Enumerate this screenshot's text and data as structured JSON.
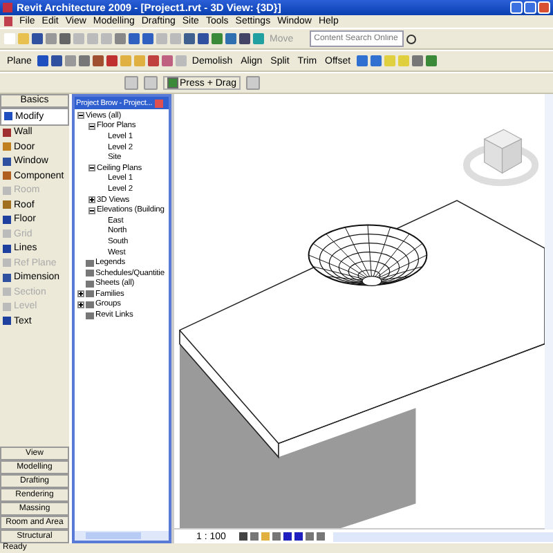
{
  "window": {
    "title": "Revit Architecture 2009 - [Project1.rvt - 3D View: {3D}]"
  },
  "menu": [
    "File",
    "Edit",
    "View",
    "Modelling",
    "Drafting",
    "Site",
    "Tools",
    "Settings",
    "Window",
    "Help"
  ],
  "toolbar": {
    "move": {
      "label": "Move",
      "disabled": true
    },
    "search": {
      "placeholder": "Content Search Online"
    }
  },
  "edit_toolbar": [
    {
      "label": "Plane"
    },
    {
      "label": "Demolish"
    },
    {
      "label": "Align"
    },
    {
      "label": "Split"
    },
    {
      "label": "Trim"
    },
    {
      "label": "Offset"
    }
  ],
  "options_bar": {
    "press_drag": {
      "label": "Press + Drag",
      "checked": true
    }
  },
  "design_bar": {
    "header": "Basics",
    "items": [
      {
        "label": "Modify",
        "selected": true,
        "disabled": false
      },
      {
        "label": "Wall",
        "selected": false,
        "disabled": false
      },
      {
        "label": "Door",
        "selected": false,
        "disabled": false
      },
      {
        "label": "Window",
        "selected": false,
        "disabled": false
      },
      {
        "label": "Component",
        "selected": false,
        "disabled": false
      },
      {
        "label": "Room",
        "selected": false,
        "disabled": true
      },
      {
        "label": "Roof",
        "selected": false,
        "disabled": false
      },
      {
        "label": "Floor",
        "selected": false,
        "disabled": false
      },
      {
        "label": "Grid",
        "selected": false,
        "disabled": true
      },
      {
        "label": "Lines",
        "selected": false,
        "disabled": false
      },
      {
        "label": "Ref Plane",
        "selected": false,
        "disabled": true
      },
      {
        "label": "Dimension",
        "selected": false,
        "disabled": false
      },
      {
        "label": "Section",
        "selected": false,
        "disabled": true
      },
      {
        "label": "Level",
        "selected": false,
        "disabled": true
      },
      {
        "label": "Text",
        "selected": false,
        "disabled": false
      }
    ],
    "tabs": [
      "View",
      "Modelling",
      "Drafting",
      "Rendering",
      "Massing",
      "Room and Area",
      "Structural"
    ]
  },
  "browser": {
    "title": "Project Brow - Project...",
    "tree": [
      {
        "label": "Views (all)",
        "expanded": true,
        "children": [
          {
            "label": "Floor Plans",
            "expanded": true,
            "children": [
              {
                "label": "Level 1"
              },
              {
                "label": "Level 2"
              },
              {
                "label": "Site"
              }
            ]
          },
          {
            "label": "Ceiling Plans",
            "expanded": true,
            "children": [
              {
                "label": "Level 1"
              },
              {
                "label": "Level 2"
              }
            ]
          },
          {
            "label": "3D Views",
            "expanded": false
          },
          {
            "label": "Elevations (Building",
            "expanded": true,
            "children": [
              {
                "label": "East"
              },
              {
                "label": "North"
              },
              {
                "label": "South"
              },
              {
                "label": "West"
              }
            ]
          }
        ]
      },
      {
        "label": "Legends"
      },
      {
        "label": "Schedules/Quantitie"
      },
      {
        "label": "Sheets (all)"
      },
      {
        "label": "Families",
        "expanded": false
      },
      {
        "label": "Groups",
        "expanded": false
      },
      {
        "label": "Revit Links"
      }
    ]
  },
  "view_bar": {
    "scale": "1 : 100"
  },
  "status_bar": {
    "text": "Ready"
  }
}
